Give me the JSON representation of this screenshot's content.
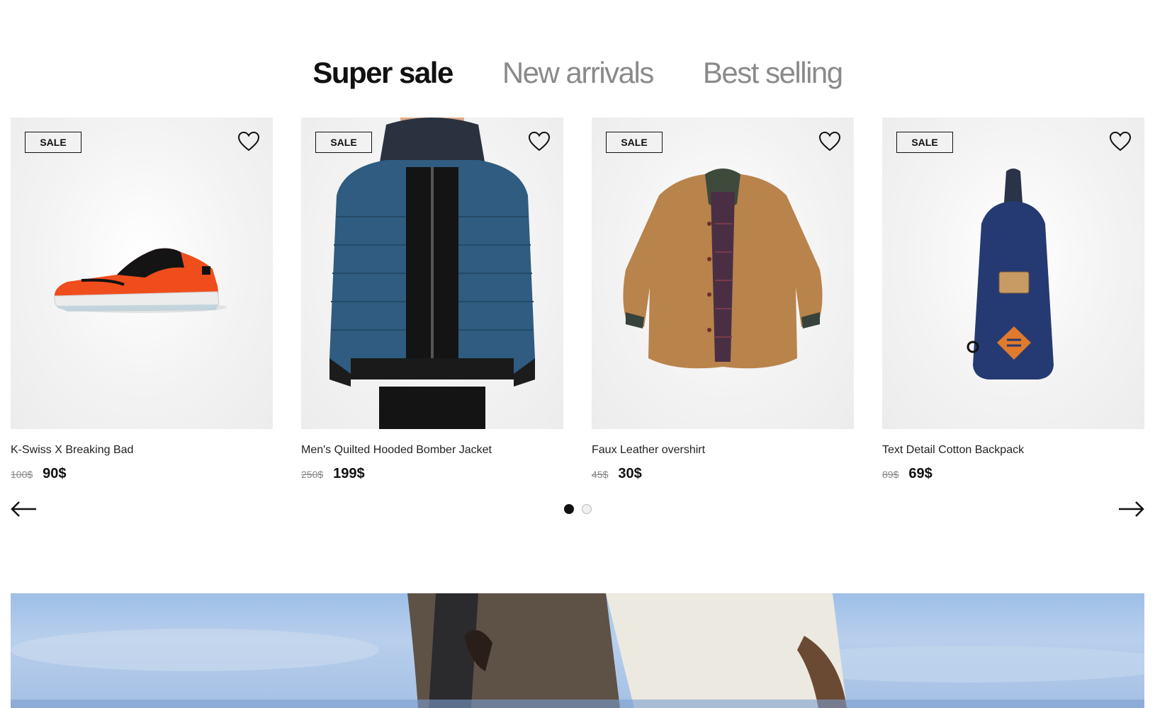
{
  "tabs": [
    {
      "label": "Super sale",
      "active": true
    },
    {
      "label": "New arrivals",
      "active": false
    },
    {
      "label": "Best selling",
      "active": false
    }
  ],
  "products": [
    {
      "badge": "SALE",
      "title": "K-Swiss X Breaking Bad",
      "old_price": "100$",
      "new_price": "90$",
      "image": "orange-sneaker-image"
    },
    {
      "badge": "SALE",
      "title": "Men's Quilted Hooded Bomber Jacket",
      "old_price": "250$",
      "new_price": "199$",
      "image": "blue-puffer-jacket-image"
    },
    {
      "badge": "SALE",
      "title": "Faux Leather overshirt",
      "old_price": "45$",
      "new_price": "30$",
      "image": "tan-overshirt-image"
    },
    {
      "badge": "SALE",
      "title": "Text Detail Cotton Backpack",
      "old_price": "89$",
      "new_price": "69$",
      "image": "navy-sling-backpack-image"
    }
  ],
  "carousel": {
    "pages": 2,
    "current_page": 1
  },
  "icons": {
    "favorite": "heart-outline-icon",
    "prev": "arrow-left-icon",
    "next": "arrow-right-icon"
  },
  "colors": {
    "accent": "#111111",
    "muted_text": "#8a8a8a",
    "card_bg": "#f2f2f2"
  }
}
